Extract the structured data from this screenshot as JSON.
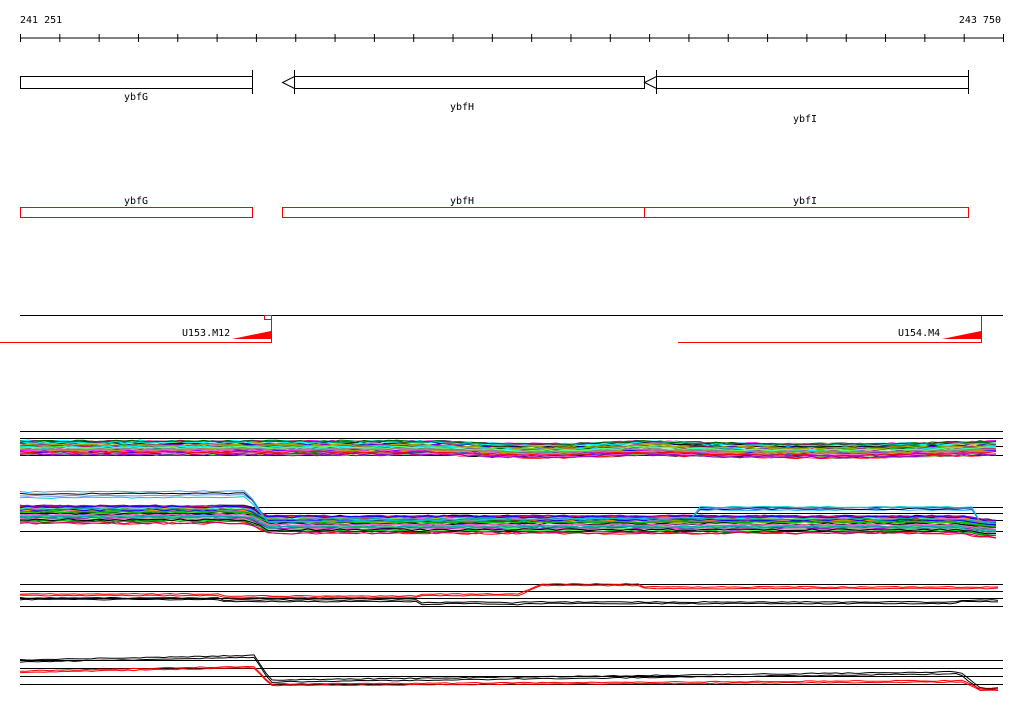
{
  "ruler": {
    "start_label": "241 251",
    "end_label": "243 750",
    "tick_count": 26
  },
  "genes": [
    {
      "name": "ybfG",
      "direction": "forward"
    },
    {
      "name": "ybfH",
      "direction": "reverse"
    },
    {
      "name": "ybfI",
      "direction": "reverse"
    }
  ],
  "annotations": [
    {
      "name": "ybfG"
    },
    {
      "name": "ybfH"
    },
    {
      "name": "ybfI"
    }
  ],
  "features": [
    {
      "name": "U153.M12"
    },
    {
      "name": "U154.M4"
    }
  ],
  "colors": {
    "gene_outline": "#000000",
    "annotation_outline": "#ff0000",
    "feature_marker": "#ff0000",
    "track_line": "#000000",
    "highlight_line": "#ff0000"
  },
  "expression_tracks": [
    {
      "name": "multi-sample track 1",
      "style": "multicolor"
    },
    {
      "name": "multi-sample track 2",
      "style": "multicolor"
    },
    {
      "name": "red-black track 3",
      "style": "red-black"
    },
    {
      "name": "red-black track 4",
      "style": "red-black"
    }
  ]
}
